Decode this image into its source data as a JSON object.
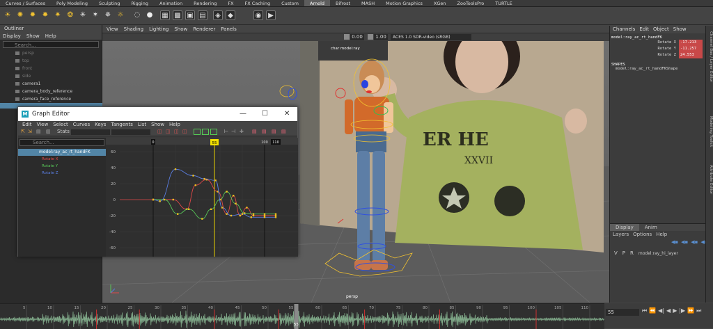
{
  "shelf": {
    "tabs": [
      "Curves / Surfaces",
      "Poly Modeling",
      "Sculpting",
      "Rigging",
      "Animation",
      "Rendering",
      "FX",
      "FX Caching",
      "Custom",
      "Arnold",
      "Bifrost",
      "MASH",
      "Motion Graphics",
      "XGen",
      "ZooToolsPro",
      "TURTLE"
    ],
    "active": "Arnold"
  },
  "outliner": {
    "title": "Outliner",
    "menu": [
      "Display",
      "Show",
      "Help"
    ],
    "search_placeholder": "Search...",
    "items": [
      {
        "label": "persp",
        "dim": true
      },
      {
        "label": "top",
        "dim": true
      },
      {
        "label": "front",
        "dim": true
      },
      {
        "label": "side",
        "dim": true
      },
      {
        "label": "camera1",
        "dim": false
      },
      {
        "label": "camera_body_reference",
        "dim": false
      },
      {
        "label": "camera_face_reference",
        "dim": false
      }
    ]
  },
  "viewport": {
    "menu": [
      "View",
      "Shading",
      "Lighting",
      "Show",
      "Renderer",
      "Panels"
    ],
    "exposure": "0.00",
    "gamma": "1.00",
    "colorspace": "ACES 1.0 SDR-video (sRGB)",
    "camera_label": "persp",
    "ref_label": "char   model:ray"
  },
  "channel_box": {
    "menu": [
      "Channels",
      "Edit",
      "Object",
      "Show"
    ],
    "node": "model:ray_ac_rt_handFK",
    "attrs": [
      {
        "name": "Rotate X",
        "value": "-17.213"
      },
      {
        "name": "Rotate Y",
        "value": "-11.257"
      },
      {
        "name": "Rotate Z",
        "value": "24.553"
      }
    ],
    "shapes_header": "SHAPES",
    "shape": "model:ray_ac_rt_handFKShape"
  },
  "layers": {
    "tabs": [
      "Display",
      "Anim"
    ],
    "menu": [
      "Layers",
      "Options",
      "Help"
    ],
    "layer_flags": [
      "V",
      "P",
      "R"
    ],
    "layer_name": "model:ray_hi_layer"
  },
  "side_tabs": [
    "Channel Box / Layer Editor",
    "Modeling Toolkit",
    "Attribute Editor"
  ],
  "graph_editor": {
    "title": "Graph Editor",
    "menu": [
      "Edit",
      "View",
      "Select",
      "Curves",
      "Keys",
      "Tangents",
      "List",
      "Show",
      "Help"
    ],
    "stats_label": "Stats",
    "search_placeholder": "Search...",
    "node": "model:ray_ac_rt_handFK",
    "curves": [
      {
        "name": "Rotate X",
        "color": "#e04848"
      },
      {
        "name": "Rotate Y",
        "color": "#58c858"
      },
      {
        "name": "Rotate Z",
        "color": "#5a7de0"
      }
    ],
    "current_frame": "55",
    "range_start_marker": "0",
    "range_end_marker": "110",
    "ruler_mid_label": "100",
    "y_ticks": [
      60,
      40,
      20,
      0,
      -20,
      -40,
      -60
    ]
  },
  "timeline": {
    "ticks": [
      "5",
      "10",
      "15",
      "20",
      "25",
      "30",
      "35",
      "40",
      "45",
      "50",
      "55",
      "60",
      "65",
      "70",
      "75",
      "80",
      "85",
      "90",
      "95",
      "100",
      "105",
      "110"
    ],
    "current": "55",
    "current_field": "55"
  }
}
